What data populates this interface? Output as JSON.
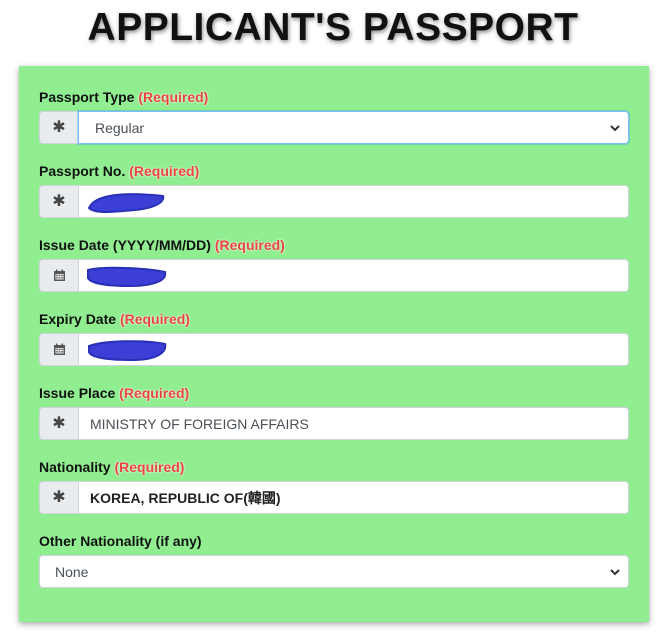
{
  "page": {
    "title": "APPLICANT'S PASSPORT"
  },
  "required_text": "(Required)",
  "fields": {
    "passport_type": {
      "label": "Passport Type",
      "value": "Regular",
      "icon": "asterisk-icon"
    },
    "passport_no": {
      "label": "Passport No.",
      "value": "",
      "icon": "asterisk-icon"
    },
    "issue_date": {
      "label": "Issue Date (YYYY/MM/DD)",
      "value": "",
      "icon": "calendar-icon"
    },
    "expiry_date": {
      "label": "Expiry Date",
      "value": "",
      "icon": "calendar-icon"
    },
    "issue_place": {
      "label": "Issue Place",
      "value": "MINISTRY OF FOREIGN AFFAIRS",
      "icon": "asterisk-icon"
    },
    "nationality": {
      "label": "Nationality",
      "value": "KOREA, REPUBLIC OF(韓國)",
      "icon": "asterisk-icon"
    },
    "other_nationality": {
      "label": "Other Nationality (if any)",
      "value": "None"
    }
  },
  "colors": {
    "panel": "#90ee90",
    "required": "#e8453c",
    "redaction": "#3b3fd6"
  }
}
